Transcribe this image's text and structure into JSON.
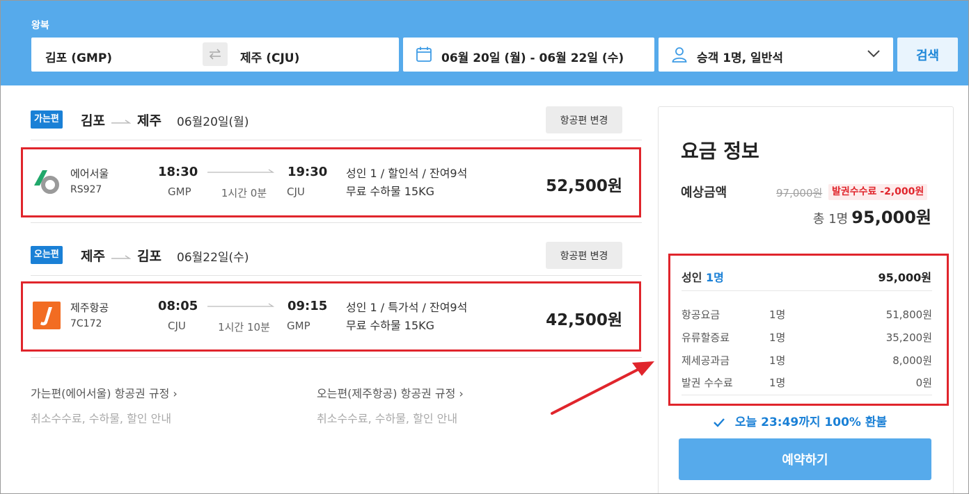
{
  "search": {
    "trip_type": "왕복",
    "origin": "김포 (GMP)",
    "destination": "제주 (CJU)",
    "dates": "06월 20일 (월)  -  06월 22일 (수)",
    "passengers": "승객 1명, 일반석",
    "search_label": "검색"
  },
  "outbound": {
    "badge": "가는편",
    "from": "김포",
    "to": "제주",
    "date": "06월20일(월)",
    "change_label": "항공편 변경",
    "flight": {
      "airline": "에어서울",
      "flight_no": "RS927",
      "dep_time": "18:30",
      "dep_code": "GMP",
      "duration": "1시간 0분",
      "arr_time": "19:30",
      "arr_code": "CJU",
      "fare": "성인 1 / 할인석 / 잔여9석",
      "baggage": "무료 수하물 15KG",
      "price": "52,500원"
    }
  },
  "inbound": {
    "badge": "오는편",
    "from": "제주",
    "to": "김포",
    "date": "06월22일(수)",
    "change_label": "항공편 변경",
    "flight": {
      "airline": "제주항공",
      "flight_no": "7C172",
      "dep_time": "08:05",
      "dep_code": "CJU",
      "duration": "1시간 10분",
      "arr_time": "09:15",
      "arr_code": "GMP",
      "fare": "성인 1 / 특가석 / 잔여9석",
      "baggage": "무료 수하물 15KG",
      "price": "42,500원"
    }
  },
  "rules": [
    {
      "link": "가는편(에어서울) 항공권 규정  ›",
      "sub": "취소수수료, 수하물, 할인 안내"
    },
    {
      "link": "오는편(제주항공) 항공권 규정  ›",
      "sub": "취소수수료, 수하물, 할인 안내"
    }
  ],
  "fare_panel": {
    "title": "요금 정보",
    "estimate_label": "예상금액",
    "original_price": "97,000원",
    "fee_discount": "발권수수료 -2,000원",
    "total_label": "총 1명",
    "total_price": "95,000원",
    "adult_label": "성인",
    "adult_count": "1명",
    "adult_total": "95,000원",
    "items": [
      {
        "label": "항공요금",
        "count": "1명",
        "amount": "51,800원"
      },
      {
        "label": "유류할증료",
        "count": "1명",
        "amount": "35,200원"
      },
      {
        "label": "제세공과금",
        "count": "1명",
        "amount": "8,000원"
      },
      {
        "label": "발권 수수료",
        "count": "1명",
        "amount": "0원"
      }
    ],
    "refund_note": "오늘 23:49까지 100% 환불",
    "book_label": "예약하기"
  },
  "colors": {
    "header_blue": "#56aaeb",
    "accent_blue": "#1a80d6",
    "highlight_red": "#e0252c"
  },
  "icons": {
    "swap": "swap-arrows-icon",
    "calendar": "calendar-icon",
    "user": "user-icon",
    "chevron": "chevron-down-icon",
    "check": "check-icon"
  }
}
